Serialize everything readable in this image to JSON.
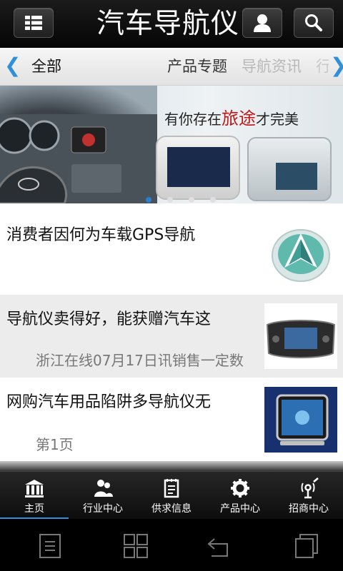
{
  "header": {
    "title": "汽车导航仪",
    "menu_icon": "grid-menu-icon",
    "user_icon": "user-icon",
    "search_icon": "search-icon"
  },
  "categories": {
    "left_arrow": "❮",
    "right_arrow": "❯",
    "items": [
      "全部",
      "产品专题",
      "导航资讯",
      "行"
    ]
  },
  "banner": {
    "slogan_before": "有你存在",
    "slogan_highlight": "旅途",
    "slogan_after": "才完美",
    "slide_count": 4,
    "active_slide": 1
  },
  "news": [
    {
      "title": "消费者因何为车载GPS导航",
      "subtitle": ""
    },
    {
      "title": "导航仪卖得好，能获赠汽车这",
      "subtitle": "浙江在线07月17日讯销售一定数"
    },
    {
      "title": "网购汽车用品陷阱多导航仪无",
      "subtitle": "第1页"
    }
  ],
  "tabs": [
    {
      "label": "主页",
      "icon": "home-bank-icon",
      "active": true
    },
    {
      "label": "行业中心",
      "icon": "people-icon",
      "active": false
    },
    {
      "label": "供求信息",
      "icon": "notepad-icon",
      "active": false
    },
    {
      "label": "产品中心",
      "icon": "gear-icon",
      "active": false
    },
    {
      "label": "招商中心",
      "icon": "antenna-icon",
      "active": false
    }
  ],
  "colors": {
    "accent": "#2f8fd8",
    "header_bg": "#111111",
    "highlight_red": "#c01818"
  }
}
